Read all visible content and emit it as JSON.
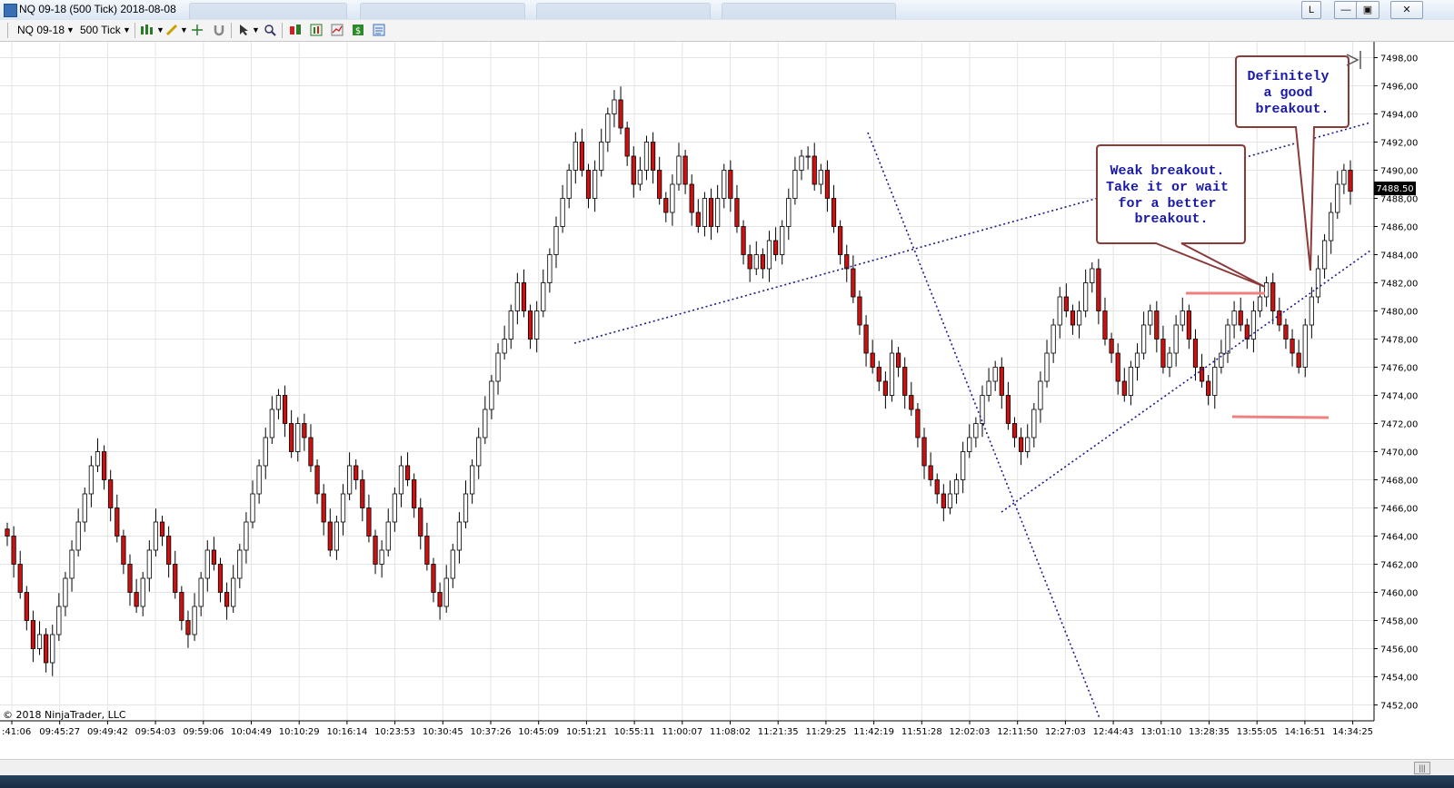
{
  "window": {
    "title": "NQ 09-18 (500 Tick)  2018-08-08",
    "buttons": [
      "L",
      "—",
      "▣",
      "✕"
    ]
  },
  "toolbar": {
    "instrument": "NQ 09-18",
    "interval": "500 Tick",
    "icons": [
      "bar-chart-icon",
      "pencil-icon",
      "crosshair-icon",
      "magnet-icon",
      "cursor-icon",
      "zoom-icon",
      "strategy-icon",
      "indicator-icon",
      "template-icon",
      "dollar-icon",
      "properties-icon"
    ]
  },
  "chart": {
    "copyright": "© 2018 NinjaTrader, LLC",
    "current_price_label": "7488.50",
    "y_ticks": [
      "7498,00",
      "7496,00",
      "7494,00",
      "7492,00",
      "7490,00",
      "7488,00",
      "7486,00",
      "7484,00",
      "7482,00",
      "7480,00",
      "7478,00",
      "7476,00",
      "7474,00",
      "7472,00",
      "7470,00",
      "7468,00",
      "7466,00",
      "7464,00",
      "7462,00",
      "7460,00",
      "7458,00",
      "7456,00",
      "7454,00",
      "7452,00"
    ],
    "x_ticks": [
      ":41:06",
      "09:45:27",
      "09:49:42",
      "09:54:03",
      "09:59:06",
      "10:04:49",
      "10:10:29",
      "10:16:14",
      "10:23:53",
      "10:30:45",
      "10:37:26",
      "10:45:09",
      "10:51:21",
      "10:55:11",
      "11:00:07",
      "11:08:02",
      "11:21:35",
      "11:29:25",
      "11:42:19",
      "11:51:28",
      "12:02:03",
      "12:11:50",
      "12:27:03",
      "12:44:43",
      "13:01:10",
      "13:28:35",
      "13:55:05",
      "14:16:51",
      "14:34:25"
    ],
    "annotations": [
      {
        "id": "weak-breakout",
        "lines": [
          "Weak breakout.",
          "Take it or wait",
          "for a better",
          "breakout."
        ]
      },
      {
        "id": "good-breakout",
        "lines": [
          "Definitely",
          "a good",
          "breakout."
        ]
      }
    ],
    "colors": {
      "up_candle": "#ffffff",
      "down_candle": "#cc1111",
      "trendline": "#1a1a8c",
      "level_line": "#f08080",
      "note_text": "#1a1aa6",
      "note_border": "#8b3a3a"
    }
  },
  "chart_data": {
    "type": "candlestick",
    "title": "",
    "ylim": [
      7451,
      7499
    ],
    "last_price": 7488.5,
    "closes": [
      7464,
      7462,
      7460,
      7458,
      7456,
      7457,
      7455,
      7457,
      7459,
      7461,
      7463,
      7465,
      7467,
      7469,
      7470,
      7468,
      7466,
      7464,
      7462,
      7460,
      7459,
      7461,
      7463,
      7465,
      7464,
      7462,
      7460,
      7458,
      7457,
      7459,
      7461,
      7463,
      7462,
      7460,
      7459,
      7461,
      7463,
      7465,
      7467,
      7469,
      7471,
      7473,
      7474,
      7472,
      7470,
      7472,
      7471,
      7469,
      7467,
      7465,
      7463,
      7465,
      7467,
      7469,
      7468,
      7466,
      7464,
      7462,
      7463,
      7465,
      7467,
      7469,
      7468,
      7466,
      7464,
      7462,
      7460,
      7459,
      7461,
      7463,
      7465,
      7467,
      7469,
      7471,
      7473,
      7475,
      7477,
      7478,
      7480,
      7482,
      7480,
      7478,
      7480,
      7482,
      7484,
      7486,
      7488,
      7490,
      7492,
      7490,
      7488,
      7490,
      7492,
      7494,
      7495,
      7493,
      7491,
      7489,
      7490,
      7492,
      7490,
      7488,
      7487,
      7489,
      7491,
      7489,
      7487,
      7486,
      7488,
      7486,
      7488,
      7490,
      7488,
      7486,
      7484,
      7483,
      7484,
      7483,
      7485,
      7484,
      7486,
      7488,
      7490,
      7491,
      7491,
      7489,
      7490,
      7488,
      7486,
      7484,
      7483,
      7481,
      7479,
      7477,
      7476,
      7475,
      7474,
      7477,
      7476,
      7474,
      7473,
      7471,
      7469,
      7468,
      7467,
      7466,
      7467,
      7468,
      7470,
      7471,
      7472,
      7474,
      7475,
      7476,
      7474,
      7472,
      7471,
      7470,
      7471,
      7473,
      7475,
      7477,
      7479,
      7481,
      7480,
      7479,
      7480,
      7482,
      7483,
      7480,
      7478,
      7477,
      7475,
      7474,
      7476,
      7477,
      7479,
      7480,
      7478,
      7476,
      7477,
      7479,
      7480,
      7478,
      7476,
      7475,
      7474,
      7476,
      7477,
      7479,
      7480,
      7479,
      7478,
      7480,
      7481,
      7482,
      7480,
      7479,
      7478,
      7477,
      7476,
      7479,
      7481,
      7483,
      7485,
      7487,
      7489,
      7490,
      7488.5
    ]
  }
}
